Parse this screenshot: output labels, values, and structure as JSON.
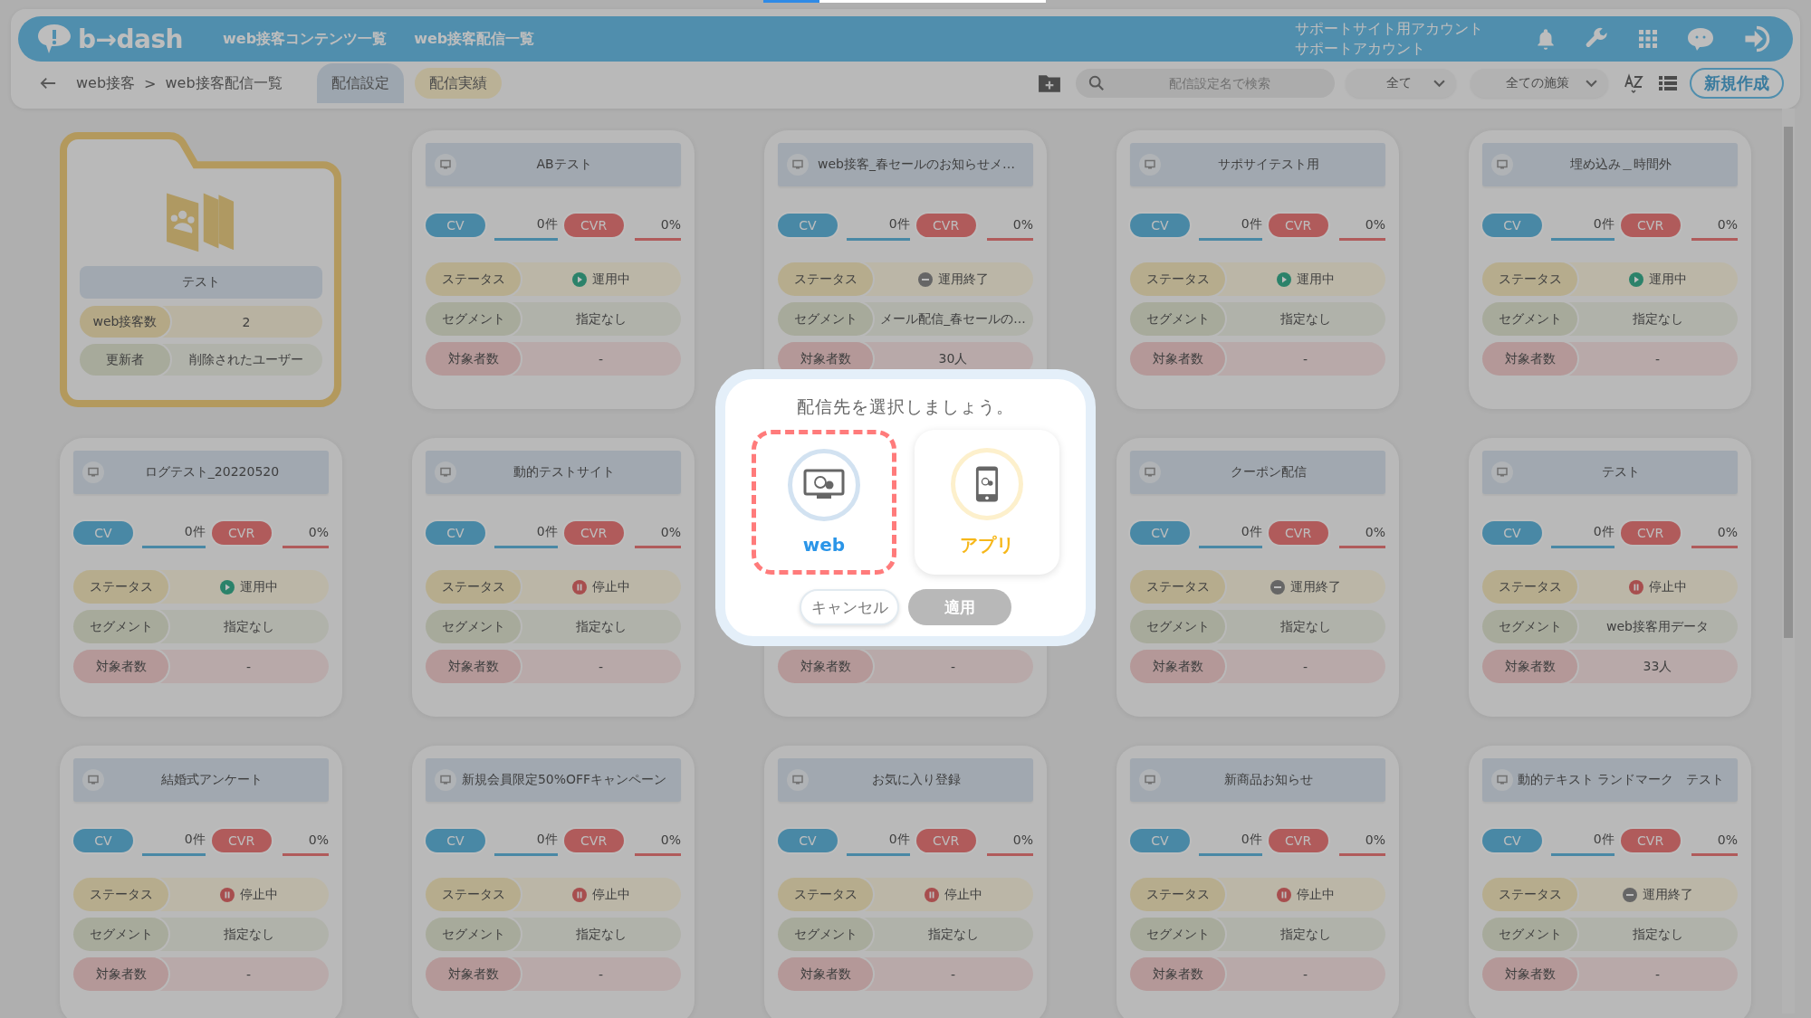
{
  "header": {
    "logo": "b→dash",
    "nav": [
      "web接客コンテンツ一覧",
      "web接客配信一覧"
    ],
    "account": [
      "サポートサイト用アカウント",
      "サポートアカウント"
    ]
  },
  "toolbar": {
    "breadcrumb": [
      "web接客",
      "web接客配信一覧"
    ],
    "separator": ">",
    "tabs": [
      {
        "label": "配信設定",
        "selected": true
      },
      {
        "label": "配信実績",
        "selected": false
      }
    ],
    "search": {
      "placeholder": "配信設定名で検索"
    },
    "filter_1": "全て",
    "filter_2": "全ての施策",
    "create_button": "新規作成"
  },
  "cards": [
    {
      "kind": "folder",
      "title": "テスト",
      "rows": [
        {
          "label": "web接客数",
          "value": "2"
        },
        {
          "label": "更新者",
          "value": "削除されたユーザー"
        }
      ]
    },
    {
      "kind": "campaign",
      "title": "ABテスト",
      "cv_label": "CV",
      "cv": "0件",
      "cvr_label": "CVR",
      "cvr": "0%",
      "status": {
        "label": "ステータス",
        "text": "運用中",
        "kind": "running"
      },
      "segment": {
        "label": "セグメント",
        "text": "指定なし"
      },
      "target": {
        "label": "対象者数",
        "text": "-"
      }
    },
    {
      "kind": "campaign",
      "title": "web接客_春セールのお知らせメ…",
      "cv_label": "CV",
      "cv": "0件",
      "cvr_label": "CVR",
      "cvr": "0%",
      "status": {
        "label": "ステータス",
        "text": "運用終了",
        "kind": "ended"
      },
      "segment": {
        "label": "セグメント",
        "text": "メール配信_春セールの..."
      },
      "target": {
        "label": "対象者数",
        "text": "30人"
      }
    },
    {
      "kind": "campaign",
      "title": "サポサイテスト用",
      "cv_label": "CV",
      "cv": "0件",
      "cvr_label": "CVR",
      "cvr": "0%",
      "status": {
        "label": "ステータス",
        "text": "運用中",
        "kind": "running"
      },
      "segment": {
        "label": "セグメント",
        "text": "指定なし"
      },
      "target": {
        "label": "対象者数",
        "text": "-"
      }
    },
    {
      "kind": "campaign",
      "title": "埋め込み＿時間外",
      "cv_label": "CV",
      "cv": "0件",
      "cvr_label": "CVR",
      "cvr": "0%",
      "status": {
        "label": "ステータス",
        "text": "運用中",
        "kind": "running"
      },
      "segment": {
        "label": "セグメント",
        "text": "指定なし"
      },
      "target": {
        "label": "対象者数",
        "text": "-"
      }
    },
    {
      "kind": "campaign",
      "title": "ログテスト_20220520",
      "cv_label": "CV",
      "cv": "0件",
      "cvr_label": "CVR",
      "cvr": "0%",
      "status": {
        "label": "ステータス",
        "text": "運用中",
        "kind": "running"
      },
      "segment": {
        "label": "セグメント",
        "text": "指定なし"
      },
      "target": {
        "label": "対象者数",
        "text": "-"
      }
    },
    {
      "kind": "campaign",
      "title": "動的テストサイト",
      "cv_label": "CV",
      "cv": "0件",
      "cvr_label": "CVR",
      "cvr": "0%",
      "status": {
        "label": "ステータス",
        "text": "停止中",
        "kind": "paused"
      },
      "segment": {
        "label": "セグメント",
        "text": "指定なし"
      },
      "target": {
        "label": "対象者数",
        "text": "-"
      }
    },
    {
      "kind": "campaign",
      "target": {
        "label": "対象者数",
        "text": "-"
      }
    },
    {
      "kind": "campaign",
      "title": "クーポン配信",
      "cv_label": "CV",
      "cv": "0件",
      "cvr_label": "CVR",
      "cvr": "0%",
      "status": {
        "label": "ステータス",
        "text": "運用終了",
        "kind": "ended"
      },
      "segment": {
        "label": "セグメント",
        "text": "指定なし"
      },
      "target": {
        "label": "対象者数",
        "text": "-"
      }
    },
    {
      "kind": "campaign",
      "title": "テスト",
      "cv_label": "CV",
      "cv": "0件",
      "cvr_label": "CVR",
      "cvr": "0%",
      "status": {
        "label": "ステータス",
        "text": "停止中",
        "kind": "paused"
      },
      "segment": {
        "label": "セグメント",
        "text": "web接客用データ"
      },
      "target": {
        "label": "対象者数",
        "text": "33人"
      }
    },
    {
      "kind": "campaign",
      "title": "結婚式アンケート",
      "cv_label": "CV",
      "cv": "0件",
      "cvr_label": "CVR",
      "cvr": "0%",
      "status": {
        "label": "ステータス",
        "text": "停止中",
        "kind": "paused"
      },
      "segment": {
        "label": "セグメント",
        "text": "指定なし"
      },
      "target": {
        "label": "対象者数",
        "text": "-"
      }
    },
    {
      "kind": "campaign",
      "title": "新規会員限定50%OFFキャンペーン",
      "cv_label": "CV",
      "cv": "0件",
      "cvr_label": "CVR",
      "cvr": "0%",
      "status": {
        "label": "ステータス",
        "text": "停止中",
        "kind": "paused"
      },
      "segment": {
        "label": "セグメント",
        "text": "指定なし"
      },
      "target": {
        "label": "対象者数",
        "text": "-"
      }
    },
    {
      "kind": "campaign",
      "title": "お気に入り登録",
      "cv_label": "CV",
      "cv": "0件",
      "cvr_label": "CVR",
      "cvr": "0%",
      "status": {
        "label": "ステータス",
        "text": "停止中",
        "kind": "paused"
      },
      "segment": {
        "label": "セグメント",
        "text": "指定なし"
      },
      "target": {
        "label": "対象者数",
        "text": "-"
      }
    },
    {
      "kind": "campaign",
      "title": "新商品お知らせ",
      "cv_label": "CV",
      "cv": "0件",
      "cvr_label": "CVR",
      "cvr": "0%",
      "status": {
        "label": "ステータス",
        "text": "停止中",
        "kind": "paused"
      },
      "segment": {
        "label": "セグメント",
        "text": "指定なし"
      },
      "target": {
        "label": "対象者数",
        "text": "-"
      }
    },
    {
      "kind": "campaign",
      "title": "動的テキスト ランドマーク　テスト",
      "cv_label": "CV",
      "cv": "0件",
      "cvr_label": "CVR",
      "cvr": "0%",
      "status": {
        "label": "ステータス",
        "text": "運用終了",
        "kind": "ended"
      },
      "segment": {
        "label": "セグメント",
        "text": "指定なし"
      },
      "target": {
        "label": "対象者数",
        "text": "-"
      }
    }
  ],
  "dialog": {
    "title": "配信先を選択しましょう。",
    "options": [
      {
        "kind": "web",
        "label": "web",
        "selected": true
      },
      {
        "kind": "app",
        "label": "アプリ",
        "selected": false
      }
    ],
    "cancel": "キャンセル",
    "apply": {
      "label": "適用",
      "disabled": true
    }
  }
}
